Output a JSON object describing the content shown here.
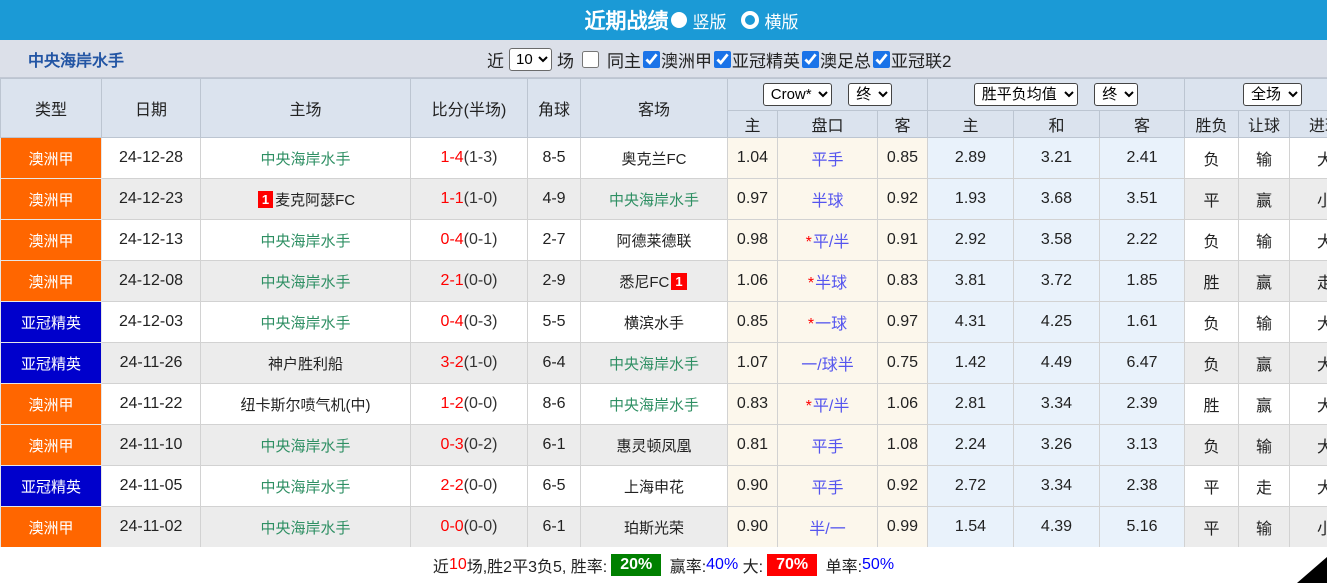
{
  "title_bar": {
    "title": "近期战绩",
    "layout_options": [
      {
        "label": "竖版",
        "selected": true
      },
      {
        "label": "横版",
        "selected": false
      }
    ]
  },
  "filter": {
    "team_name": "中央海岸水手",
    "recent_label": "近",
    "recent_value": "10",
    "recent_suffix": "场",
    "same_home_label": "同主",
    "same_home_checked": false,
    "leagues": [
      {
        "label": "澳洲甲",
        "checked": true
      },
      {
        "label": "亚冠精英",
        "checked": true
      },
      {
        "label": "澳足总",
        "checked": true
      },
      {
        "label": "亚冠联2",
        "checked": true
      }
    ]
  },
  "table": {
    "selects": {
      "odds_company": "Crow*",
      "odds_time_handicap": "终",
      "avg_label": "胜平负均值",
      "odds_time_avg": "终",
      "scope": "全场"
    },
    "headers": {
      "type": "类型",
      "date": "日期",
      "home": "主场",
      "score": "比分(半场)",
      "corner": "角球",
      "away": "客场",
      "handicap_home": "主",
      "handicap": "盘口",
      "handicap_away": "客",
      "avg_win": "主",
      "avg_draw": "和",
      "avg_lose": "客",
      "result": "胜负",
      "handicap_result": "让球",
      "goals": "进球"
    },
    "focal_team": "中央海岸水手",
    "type_colors": {
      "澳洲甲": "orange",
      "亚冠精英": "blue"
    },
    "rows": [
      {
        "type": "澳洲甲",
        "date": "24-12-28",
        "home": "中央海岸水手",
        "home_badge": "",
        "score": "1-4",
        "half": "(1-3)",
        "corner": "8-5",
        "away": "奥克兰FC",
        "away_badge": "",
        "h": "1.04",
        "handicap": "平手",
        "star": false,
        "a": "0.85",
        "w": "2.89",
        "d": "3.21",
        "l": "2.41",
        "result": "负",
        "handicap_result": "输",
        "goals": "大"
      },
      {
        "type": "澳洲甲",
        "date": "24-12-23",
        "home": "麦克阿瑟FC",
        "home_badge": "1",
        "score": "1-1",
        "half": "(1-0)",
        "corner": "4-9",
        "away": "中央海岸水手",
        "away_badge": "",
        "h": "0.97",
        "handicap": "半球",
        "star": false,
        "a": "0.92",
        "w": "1.93",
        "d": "3.68",
        "l": "3.51",
        "result": "平",
        "handicap_result": "赢",
        "goals": "小"
      },
      {
        "type": "澳洲甲",
        "date": "24-12-13",
        "home": "中央海岸水手",
        "home_badge": "",
        "score": "0-4",
        "half": "(0-1)",
        "corner": "2-7",
        "away": "阿德莱德联",
        "away_badge": "",
        "h": "0.98",
        "handicap": "平/半",
        "star": true,
        "a": "0.91",
        "w": "2.92",
        "d": "3.58",
        "l": "2.22",
        "result": "负",
        "handicap_result": "输",
        "goals": "大"
      },
      {
        "type": "澳洲甲",
        "date": "24-12-08",
        "home": "中央海岸水手",
        "home_badge": "",
        "score": "2-1",
        "half": "(0-0)",
        "corner": "2-9",
        "away": "悉尼FC",
        "away_badge": "1",
        "h": "1.06",
        "handicap": "半球",
        "star": true,
        "a": "0.83",
        "w": "3.81",
        "d": "3.72",
        "l": "1.85",
        "result": "胜",
        "handicap_result": "赢",
        "goals": "走"
      },
      {
        "type": "亚冠精英",
        "date": "24-12-03",
        "home": "中央海岸水手",
        "home_badge": "",
        "score": "0-4",
        "half": "(0-3)",
        "corner": "5-5",
        "away": "横滨水手",
        "away_badge": "",
        "h": "0.85",
        "handicap": "一球",
        "star": true,
        "a": "0.97",
        "w": "4.31",
        "d": "4.25",
        "l": "1.61",
        "result": "负",
        "handicap_result": "输",
        "goals": "大"
      },
      {
        "type": "亚冠精英",
        "date": "24-11-26",
        "home": "神户胜利船",
        "home_badge": "",
        "score": "3-2",
        "half": "(1-0)",
        "corner": "6-4",
        "away": "中央海岸水手",
        "away_badge": "",
        "h": "1.07",
        "handicap": "一/球半",
        "star": false,
        "a": "0.75",
        "w": "1.42",
        "d": "4.49",
        "l": "6.47",
        "result": "负",
        "handicap_result": "赢",
        "goals": "大"
      },
      {
        "type": "澳洲甲",
        "date": "24-11-22",
        "home": "纽卡斯尔喷气机(中)",
        "home_badge": "",
        "score": "1-2",
        "half": "(0-0)",
        "corner": "8-6",
        "away": "中央海岸水手",
        "away_badge": "",
        "h": "0.83",
        "handicap": "平/半",
        "star": true,
        "a": "1.06",
        "w": "2.81",
        "d": "3.34",
        "l": "2.39",
        "result": "胜",
        "handicap_result": "赢",
        "goals": "大"
      },
      {
        "type": "澳洲甲",
        "date": "24-11-10",
        "home": "中央海岸水手",
        "home_badge": "",
        "score": "0-3",
        "half": "(0-2)",
        "corner": "6-1",
        "away": "惠灵顿凤凰",
        "away_badge": "",
        "h": "0.81",
        "handicap": "平手",
        "star": false,
        "a": "1.08",
        "w": "2.24",
        "d": "3.26",
        "l": "3.13",
        "result": "负",
        "handicap_result": "输",
        "goals": "大"
      },
      {
        "type": "亚冠精英",
        "date": "24-11-05",
        "home": "中央海岸水手",
        "home_badge": "",
        "score": "2-2",
        "half": "(0-0)",
        "corner": "6-5",
        "away": "上海申花",
        "away_badge": "",
        "h": "0.90",
        "handicap": "平手",
        "star": false,
        "a": "0.92",
        "w": "2.72",
        "d": "3.34",
        "l": "2.38",
        "result": "平",
        "handicap_result": "走",
        "goals": "大"
      },
      {
        "type": "澳洲甲",
        "date": "24-11-02",
        "home": "中央海岸水手",
        "home_badge": "",
        "score": "0-0",
        "half": "(0-0)",
        "corner": "6-1",
        "away": "珀斯光荣",
        "away_badge": "",
        "h": "0.90",
        "handicap": "半/一",
        "star": false,
        "a": "0.99",
        "w": "1.54",
        "d": "4.39",
        "l": "5.16",
        "result": "平",
        "handicap_result": "输",
        "goals": "小"
      }
    ]
  },
  "value_colors": {
    "胜": "c-red",
    "平": "c-blue",
    "负": "c-green",
    "赢": "c-red",
    "走": "c-blue",
    "输": "c-green",
    "大": "c-red",
    "小": "c-green"
  },
  "footer": {
    "segments": [
      {
        "text": "近",
        "style": "text"
      },
      {
        "text": "10",
        "style": "red-text"
      },
      {
        "text": "场,胜2平3负5, 胜率:",
        "style": "text"
      },
      {
        "text": "20%",
        "style": "green-badge"
      },
      {
        "text": " 赢率:",
        "style": "text"
      },
      {
        "text": "40%",
        "style": "blue-text"
      },
      {
        "text": " 大:",
        "style": "text"
      },
      {
        "text": "70%",
        "style": "red-badge"
      },
      {
        "text": " 单率:",
        "style": "text"
      },
      {
        "text": "50%",
        "style": "blue-text"
      }
    ]
  },
  "colors": {
    "titlebar": "#1b9ad6",
    "league_orange": "#ff6600",
    "league_blue": "#0000cc",
    "focal_team_green": "#2e8f63",
    "score_red": "#ff0000",
    "handicap_blue": "#5555ee",
    "win_rate_badge": "#008000",
    "over_rate_badge": "#ff0000"
  }
}
